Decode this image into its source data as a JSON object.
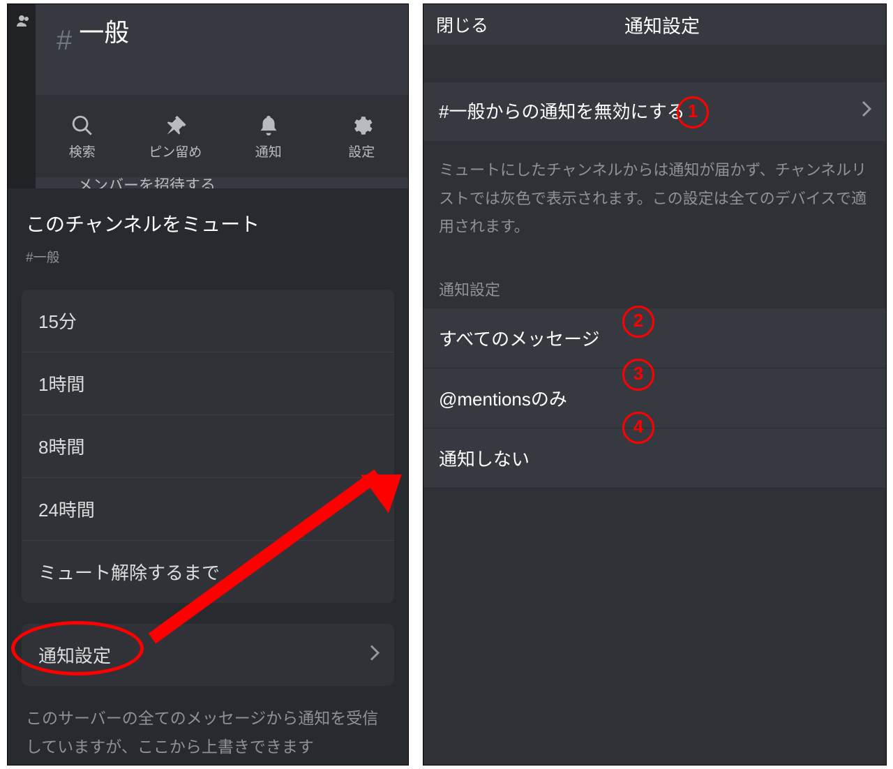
{
  "left": {
    "header": {
      "hash": "#",
      "channel_name": "一般"
    },
    "action_bar": {
      "search": "検索",
      "pin": "ピン留め",
      "notify": "通知",
      "settings": "設定"
    },
    "peek_label": "メンバーを招待する",
    "sheet": {
      "title": "このチャンネルをミュート",
      "sub": "#一般",
      "mute_options": [
        "15分",
        "1時間",
        "8時間",
        "24時間",
        "ミュート解除するまで"
      ],
      "ns_button": "通知設定",
      "ns_footer": "このサーバーの全てのメッセージから通知を受信していますが、ここから上書きできます"
    }
  },
  "right": {
    "close_label": "閉じる",
    "title": "通知設定",
    "disable_label": "#一般からの通知を無効にする",
    "disable_expl": "ミュートにしたチャンネルからは通知が届かず、チャンネルリストでは灰色で表示されます。この設定は全てのデバイスで適用されます。",
    "section_label": "通知設定",
    "options": [
      "すべてのメッセージ",
      "@mentionsのみ",
      "通知しない"
    ]
  },
  "annotations": {
    "n1": "1",
    "n2": "2",
    "n3": "3",
    "n4": "4"
  }
}
